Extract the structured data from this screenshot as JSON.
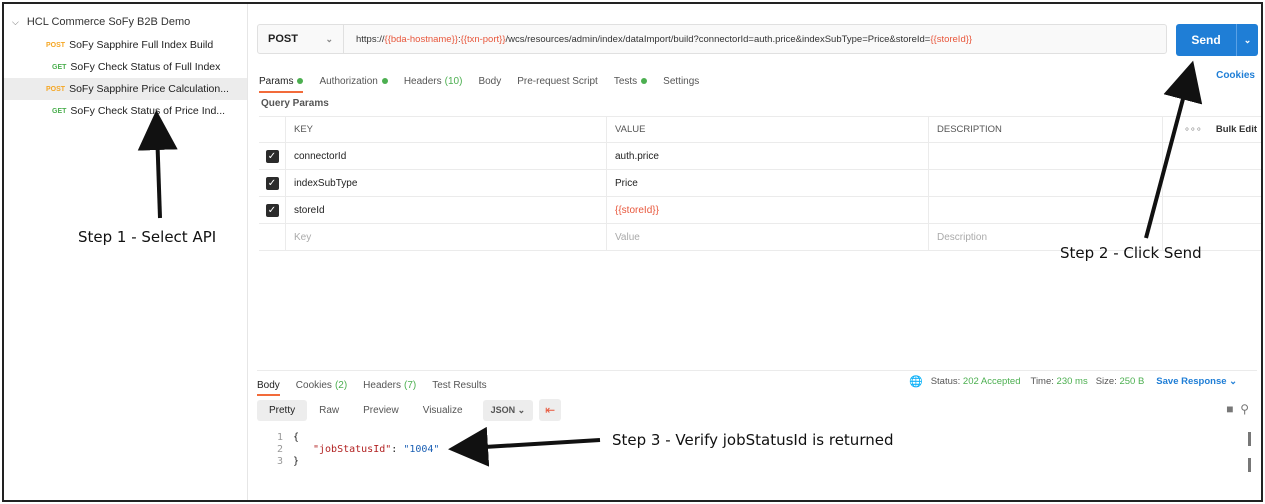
{
  "sidebar": {
    "collection": "HCL Commerce SoFy B2B Demo",
    "items": [
      {
        "method": "POST",
        "name": "SoFy Sapphire Full Index Build",
        "selected": false
      },
      {
        "method": "GET",
        "name": "SoFy Check Status of Full Index",
        "selected": false
      },
      {
        "method": "POST",
        "name": "SoFy Sapphire Price Calculation...",
        "selected": true
      },
      {
        "method": "GET",
        "name": "SoFy Check Status of Price Ind...",
        "selected": false
      }
    ]
  },
  "request": {
    "method": "POST",
    "url_parts": [
      {
        "text": "https://",
        "var": false
      },
      {
        "text": "{{bda-hostname}}",
        "var": true
      },
      {
        "text": ":",
        "var": false
      },
      {
        "text": "{{txn-port}}",
        "var": true
      },
      {
        "text": "/wcs/resources/admin/index/dataImport/build?connectorId=auth.price&indexSubType=Price&storeId=",
        "var": false
      },
      {
        "text": "{{storeId}}",
        "var": true
      }
    ],
    "send_label": "Send"
  },
  "tabs": {
    "params": "Params",
    "authorization": "Authorization",
    "headers": "Headers",
    "headers_count": "(10)",
    "body": "Body",
    "prerequest": "Pre-request Script",
    "tests": "Tests",
    "settings": "Settings",
    "cookies": "Cookies"
  },
  "query_params": {
    "title": "Query Params",
    "headers": {
      "key": "KEY",
      "value": "VALUE",
      "description": "DESCRIPTION",
      "more": "∘∘∘",
      "bulk_edit": "Bulk Edit"
    },
    "rows": [
      {
        "key": "connectorId",
        "value": "auth.price",
        "var": false,
        "checked": true
      },
      {
        "key": "indexSubType",
        "value": "Price",
        "var": false,
        "checked": true
      },
      {
        "key": "storeId",
        "value": "{{storeId}}",
        "var": true,
        "checked": true
      }
    ],
    "placeholder": {
      "key": "Key",
      "value": "Value",
      "description": "Description"
    }
  },
  "response": {
    "tabs": {
      "body": "Body",
      "cookies": "Cookies",
      "cookies_count": "(2)",
      "headers": "Headers",
      "headers_count": "(7)",
      "test_results": "Test Results"
    },
    "status_label": "Status:",
    "status_value": "202 Accepted",
    "time_label": "Time:",
    "time_value": "230 ms",
    "size_label": "Size:",
    "size_value": "250 B",
    "save_response": "Save Response",
    "views": {
      "pretty": "Pretty",
      "raw": "Raw",
      "preview": "Preview",
      "visualize": "Visualize",
      "format": "JSON"
    },
    "code_lines": [
      {
        "n": "1",
        "text": "{"
      },
      {
        "n": "2",
        "key": "\"jobStatusId\"",
        "sep": ": ",
        "val": "\"1004\""
      },
      {
        "n": "3",
        "text": "}"
      }
    ]
  },
  "annotations": {
    "step1": "Step 1 - Select API",
    "step2": "Step 2 - Click Send",
    "step3": "Step 3 - Verify jobStatusId is returned"
  },
  "colors": {
    "accent": "#1f7ed6",
    "method_post": "#f5a623",
    "method_get": "#4caf50",
    "variable": "#e8573c",
    "active_tab": "#f26b3a"
  }
}
